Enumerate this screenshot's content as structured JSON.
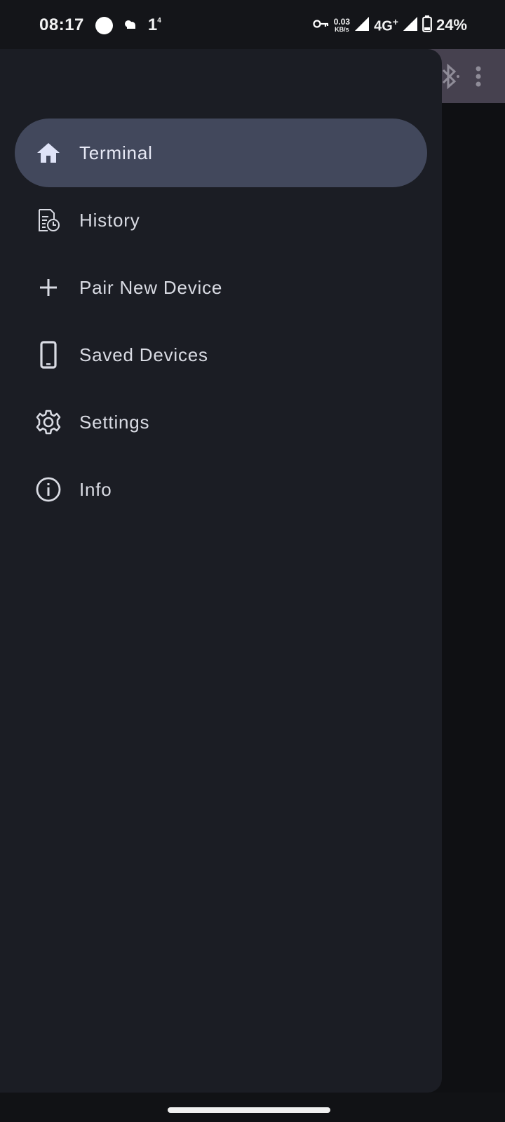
{
  "status_bar": {
    "time": "08:17",
    "weather_temp": "1",
    "weather_sup": "4",
    "speed_value": "0.03",
    "speed_unit": "KB/s",
    "network": "4G",
    "network_sup": "+",
    "battery": "24%",
    "icons": [
      "notification-dot-icon",
      "weather-icon",
      "vpn-key-icon",
      "signal-icon",
      "battery-icon"
    ]
  },
  "background_app": {
    "icons": [
      "bluetooth-icon",
      "more-vert-icon"
    ],
    "appbar_color": "#46414f"
  },
  "drawer": {
    "background": "#1b1d24",
    "active_color": "#42485c",
    "items": [
      {
        "label": "Terminal",
        "icon": "home-icon",
        "active": true
      },
      {
        "label": "History",
        "icon": "history-document-icon",
        "active": false
      },
      {
        "label": "Pair New Device",
        "icon": "plus-icon",
        "active": false
      },
      {
        "label": "Saved Devices",
        "icon": "phone-icon",
        "active": false
      },
      {
        "label": "Settings",
        "icon": "gear-icon",
        "active": false
      },
      {
        "label": "Info",
        "icon": "info-icon",
        "active": false
      }
    ]
  }
}
